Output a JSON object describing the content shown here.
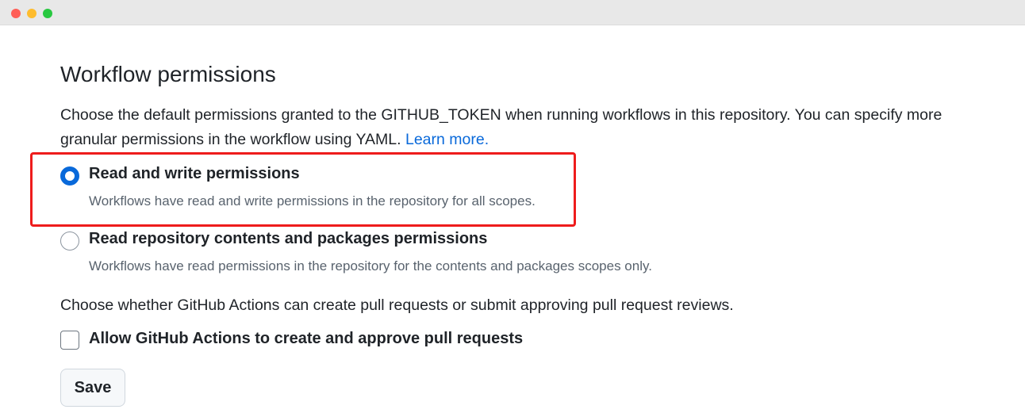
{
  "window": {
    "traffic_lights": [
      "close",
      "minimize",
      "zoom"
    ]
  },
  "section": {
    "title": "Workflow permissions",
    "description": "Choose the default permissions granted to the GITHUB_TOKEN when running workflows in this repository. You can specify more granular permissions in the workflow using YAML.",
    "learn_more": "Learn more."
  },
  "options": [
    {
      "label": "Read and write permissions",
      "hint": "Workflows have read and write permissions in the repository for all scopes.",
      "checked": true
    },
    {
      "label": "Read repository contents and packages permissions",
      "hint": "Workflows have read permissions in the repository for the contents and packages scopes only.",
      "checked": false
    }
  ],
  "pull_requests": {
    "description": "Choose whether GitHub Actions can create pull requests or submit approving pull request reviews.",
    "checkbox_label": "Allow GitHub Actions to create and approve pull requests",
    "checked": false
  },
  "actions": {
    "save_label": "Save"
  },
  "colors": {
    "accent": "#0969da",
    "highlight": "#ee1c1c",
    "text": "#1f2328",
    "muted": "#59636e"
  }
}
